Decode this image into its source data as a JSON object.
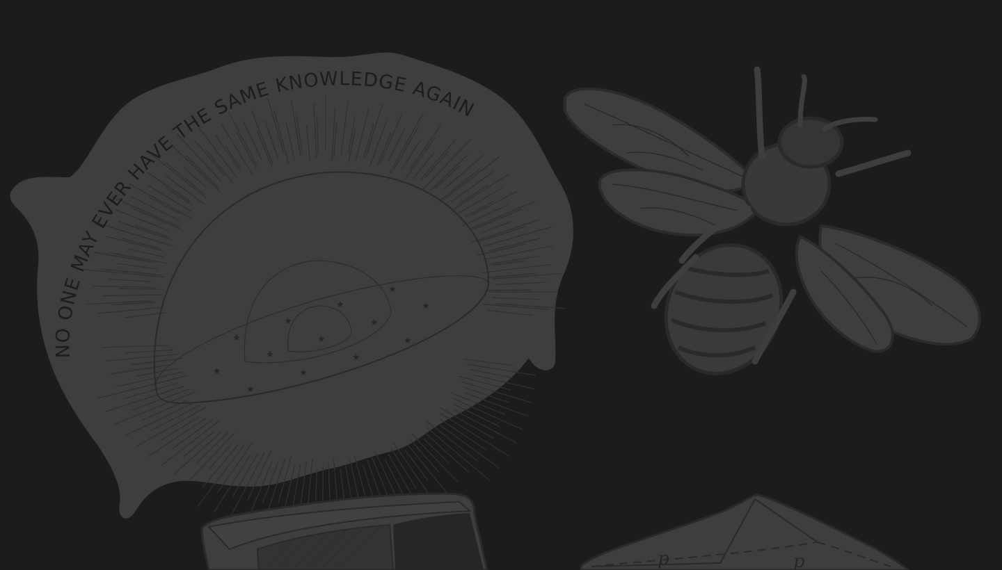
{
  "stickers": {
    "dome": {
      "arc_text": "NO ONE MAY EVER HAVE THE SAME KNOWLEDGE AGAIN"
    },
    "bee": {},
    "book": {},
    "prism": {
      "labels": [
        "p",
        "p"
      ]
    }
  },
  "colors": {
    "background": "#1c1c1c",
    "sticker_fill": "#3e3e3e",
    "ink": "#2a2a2a"
  }
}
